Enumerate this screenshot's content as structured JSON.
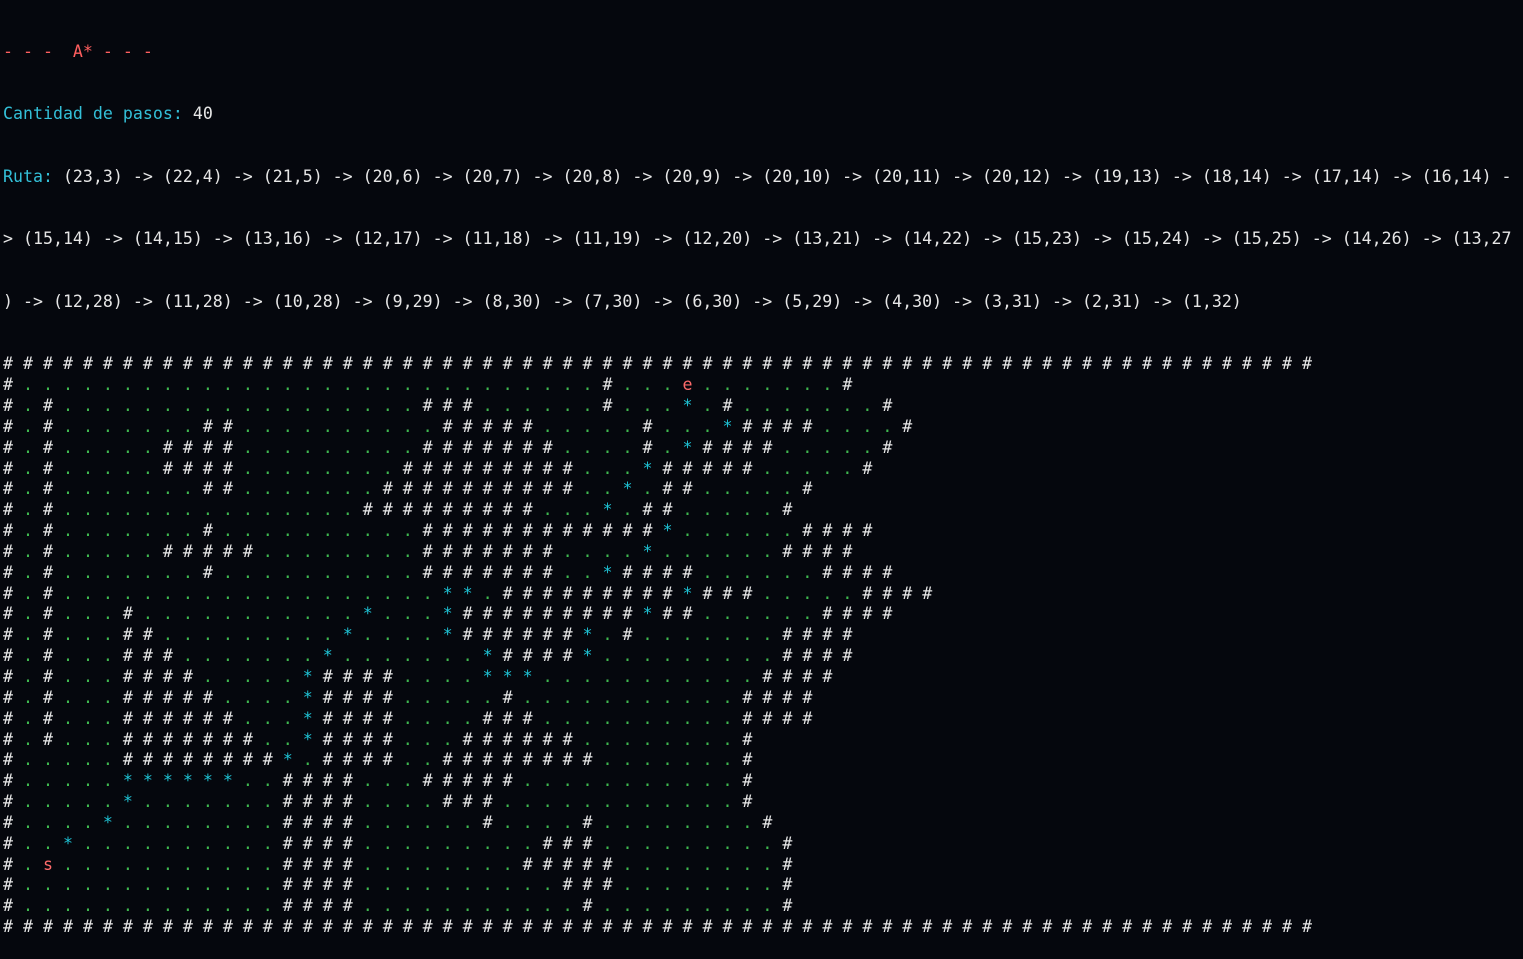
{
  "header": {
    "title": "- - -  A* - - -",
    "steps_label": "Cantidad de pasos:",
    "steps_value": "40",
    "route_label": "Ruta:",
    "route_lines": [
      " (23,3) -> (22,4) -> (21,5) -> (20,6) -> (20,7) -> (20,8) -> (20,9) -> (20,10) -> (20,11) -> (20,12) -> (19,13) -> (18,14) -> (17,14) -> (16,14) -",
      "> (15,14) -> (14,15) -> (13,16) -> (12,17) -> (11,18) -> (11,19) -> (12,20) -> (13,21) -> (14,22) -> (15,23) -> (15,24) -> (15,25) -> (14,26) -> (13,27",
      ") -> (12,28) -> (11,28) -> (10,28) -> (9,29) -> (8,30) -> (7,30) -> (6,30) -> (5,29) -> (4,30) -> (3,31) -> (2,31) -> (1,32)"
    ]
  },
  "colors": {
    "background": "#05070d",
    "text": "#e6e6e6",
    "title": "#ff5f5f",
    "label": "#33c0d8",
    "wall": "#e6e6e6",
    "floor": "#3fb950",
    "path": "#1fc4d6",
    "markers": "#ff6b6b"
  },
  "maze": [
    "##################################################################",
    "#.............................#...e.......#",
    "#.#..................###......#...*.#.......#",
    "#.#.......##..........#####.....#...*####....#",
    "#.#.....####.........#######....#.*####.....#",
    "#.#.....####........#########...*#####.....#",
    "#.#.......##.......##########..*.##.....#",
    "#.#...............#########...*.##.....#",
    "#.#.......#..........############*......####",
    "#.#.....#####........#######....*......####",
    "#.#.......#..........#######..*####......####",
    "#.#...................**.#########*###.....####",
    "#.#...#...........*...*#########*##......####",
    "#.#...##.........*....*######*.#.......####",
    "#.#...###.......*.......*####*.........####",
    "#.#...####.....*####....***...........####",
    "#.#...#####....*####.....#...........####",
    "#.#...######...*####....###..........####",
    "#.#...#######..*####...######........#",
    "#.....########*.####..########.......#",
    "#.....******..####...#####...........#",
    "#.....*.......####....###............#",
    "#....*........####......#....#........#",
    "#..*..........####.........###.........#",
    "#.s...........####........#####........#",
    "#.............####..........###........#",
    "#.............####...........#.........#",
    "##################################################################"
  ]
}
